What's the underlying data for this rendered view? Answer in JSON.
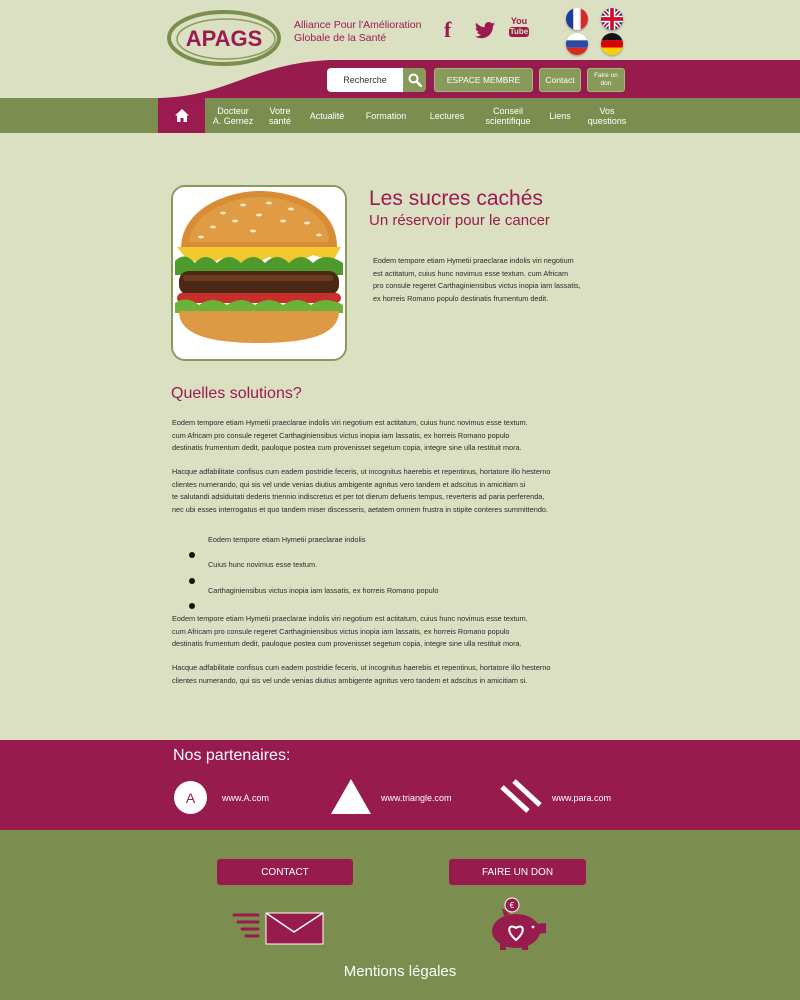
{
  "brand": {
    "logo_text": "APAGS",
    "tagline_line1": "Alliance Pour l'Amélioration",
    "tagline_line2": "Globale de la Santé"
  },
  "social": {
    "facebook": "f",
    "youtube_top": "You",
    "youtube_bottom": "Tube"
  },
  "header": {
    "search_placeholder": "Recherche",
    "member_label": "ESPACE MEMBRE",
    "contact_label": "Contact",
    "donate_line1": "Faire un",
    "donate_line2": "don"
  },
  "nav": {
    "items": [
      {
        "line1": "Docteur",
        "line2": "A. Gernez"
      },
      {
        "line1": "Votre",
        "line2": "santé"
      },
      {
        "line1": "Actualité",
        "line2": ""
      },
      {
        "line1": "Formation",
        "line2": ""
      },
      {
        "line1": "Lectures",
        "line2": ""
      },
      {
        "line1": "Conseil",
        "line2": "scientifique"
      },
      {
        "line1": "Liens",
        "line2": ""
      },
      {
        "line1": "Vos",
        "line2": "questions"
      }
    ]
  },
  "article": {
    "title": "Les sucres cachés",
    "subtitle": "Un réservoir pour le cancer",
    "intro": [
      "Eodem tempore etiam Hymetii praeclarae indolis viri negotium",
      "est actitatum, cuius hunc novimus esse textum. cum Africam",
      "pro consule regeret Carthaginiensibus victus inopia iam lassatis,",
      "ex horreis Romano populo destinatis frumentum dedit."
    ],
    "section_title": "Quelles solutions?",
    "para1": [
      "Eodem tempore etiam Hymetii praeclarae indolis viri negotium est actitatum, cuius hunc novimus esse textum.",
      "cum Africam pro consule regeret Carthaginiensibus victus inopia iam lassatis, ex horreis Romano populo",
      "destinatis frumentum dedit, pauloque postea cum provenisset segetum copia, integre sine ulla restituit mora."
    ],
    "para2": [
      "Hacque adfabilitate confisus cum eadem postridie feceris, ut incognitus haerebis et repentinus, hortatore illo hesterno",
      "clientes numerando, qui sis vel unde venias diutius ambigente agnitus vero tandem et adscitus in amicitiam si",
      "te salutandi adsiduitati dederis triennio indiscretus et per tot dierum defueris tempus, reverteris ad paria perferenda,",
      "nec ubi esses interrogatus et quo tandem miser discesseris, aetatem omnem frustra in stipite conteres summittendo."
    ],
    "bullets": [
      "Eodem tempore etiam Hymetii praeclarae indolis",
      "Cuius hunc novimus esse textum.",
      "Carthaginiensibus victus inopia iam lassatis, ex horreis Romano populo"
    ],
    "para3": [
      "Eodem tempore etiam Hymetii praeclarae indolis viri negotium est actitatum, cuius hunc novimus esse textum.",
      "cum Africam pro consule regeret Carthaginiensibus victus inopia iam lassatis, ex horreis Romano populo",
      "destinatis frumentum dedit, pauloque postea cum provenisset segetum copia, integre sine ulla restituit mora."
    ],
    "para4": [
      "Hacque adfabilitate confisus cum eadem postridie feceris, ut incognitus haerebis et repentinus, hortatore illo hesterno",
      "clientes numerando, qui sis vel unde venias diutius ambigente agnitus vero tandem et adscitus in amicitiam si."
    ]
  },
  "partners": {
    "title": "Nos partenaires:",
    "a_letter": "A",
    "a_url": "www.A.com",
    "triangle_url": "www.triangle.com",
    "para_url": "www.para.com"
  },
  "footer": {
    "contact_label": "CONTACT",
    "donate_label": "FAIRE UN DON",
    "coin_symbol": "€",
    "legal": "Mentions légales"
  },
  "colors": {
    "brand": "#9b1b51",
    "olive": "#7c8e4f",
    "background": "#dbe0c2"
  }
}
